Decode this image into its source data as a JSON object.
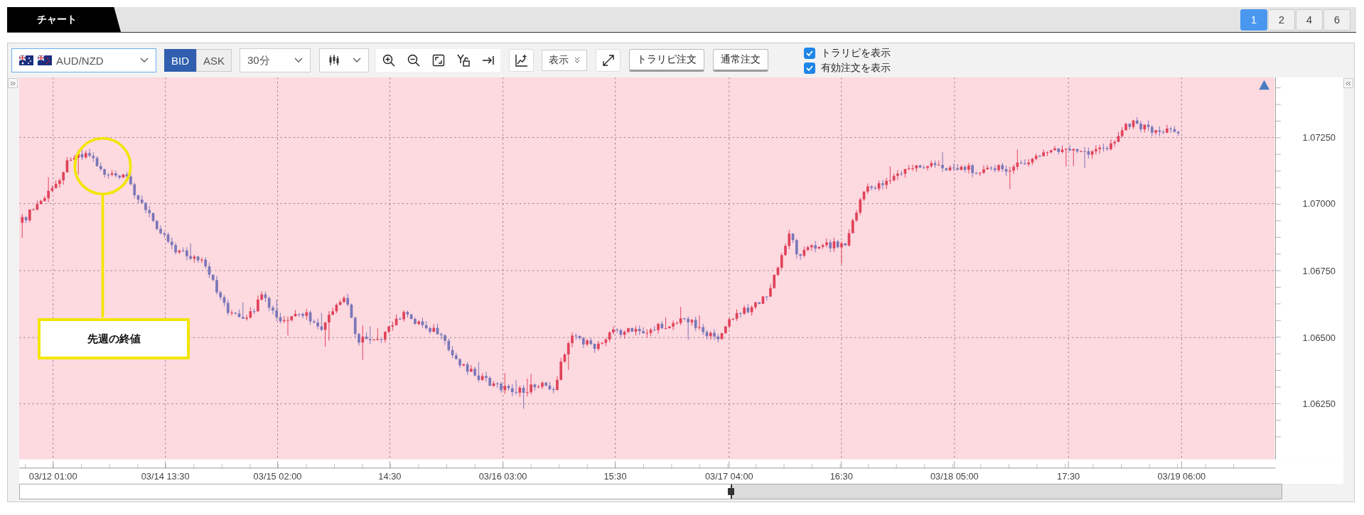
{
  "tabs": [
    {
      "label": "チャート",
      "selected": true
    }
  ],
  "layout_buttons": [
    {
      "label": "1",
      "selected": true
    },
    {
      "label": "2",
      "selected": false
    },
    {
      "label": "4",
      "selected": false
    },
    {
      "label": "6",
      "selected": false
    }
  ],
  "toolbar": {
    "symbol": "AUD/NZD",
    "price_side": [
      {
        "label": "BID",
        "selected": true
      },
      {
        "label": "ASK",
        "selected": false
      }
    ],
    "timeframe": "30分",
    "display_menu": "表示",
    "order_buttons": [
      "トラリピ注文",
      "通常注文"
    ],
    "options": [
      {
        "label": "トラリピを表示",
        "checked": true
      },
      {
        "label": "有効注文を表示",
        "checked": true
      }
    ]
  },
  "chart": {
    "y_axis_labels": [
      "1.07250",
      "1.07000",
      "1.06750",
      "1.06500",
      "1.06250"
    ],
    "x_axis_labels": [
      "03/12 01:00",
      "03/14 13:30",
      "03/15 02:00",
      "14:30",
      "03/16 03:00",
      "15:30",
      "03/17 04:00",
      "16:30",
      "03/18 05:00",
      "17:30",
      "03/19 06:00"
    ],
    "annotation": {
      "text": "先週の終値"
    }
  }
}
